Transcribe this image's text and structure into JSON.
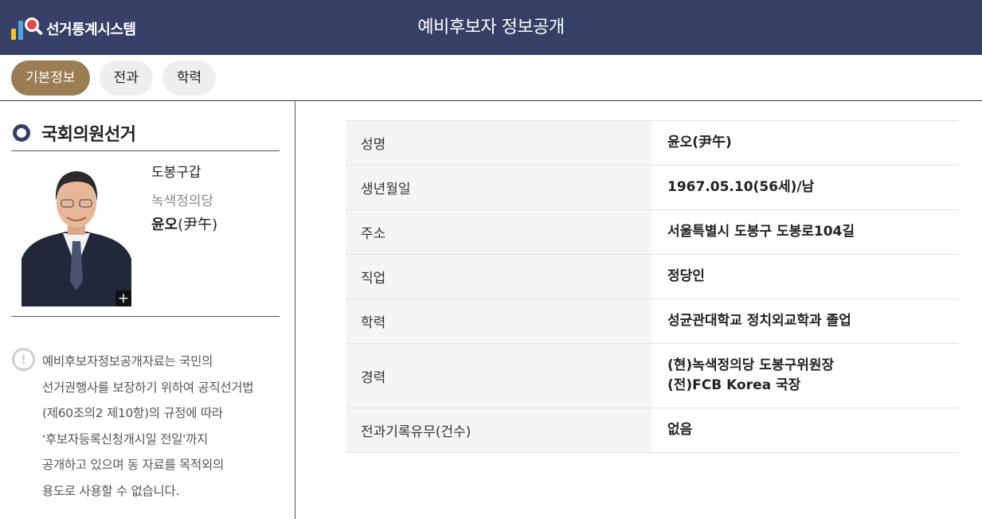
{
  "header": {
    "logo_text": "선거통계시스템",
    "title": "예비후보자 정보공개"
  },
  "tabs": [
    {
      "label": "기본정보",
      "active": true
    },
    {
      "label": "전과",
      "active": false
    },
    {
      "label": "학력",
      "active": false
    }
  ],
  "election": {
    "title": "국회의원선거"
  },
  "candidate": {
    "district": "도봉구갑",
    "party": "녹색정의당",
    "name_hangul": "윤오",
    "name_hanja": "(尹午)",
    "zoom_symbol": "+"
  },
  "notice": {
    "icon": "!",
    "lines": [
      "예비후보자정보공개자료는 국민의",
      "선거권행사를 보장하기 위하여 공직선거법",
      "(제60조의2 제10항)의 규정에 따라",
      "'후보자등록신청개시일 전일'까지",
      "공개하고 있으며 동 자료를 목적외의",
      "용도로 사용할 수 없습니다."
    ]
  },
  "info_rows": [
    {
      "label": "성명",
      "values": [
        "윤오(尹午)"
      ]
    },
    {
      "label": "생년월일",
      "values": [
        "1967.05.10(56세)/남"
      ]
    },
    {
      "label": "주소",
      "values": [
        "서울특별시 도봉구 도봉로104길"
      ]
    },
    {
      "label": "직업",
      "values": [
        "정당인"
      ]
    },
    {
      "label": "학력",
      "values": [
        "성균관대학교 정치외교학과 졸업"
      ]
    },
    {
      "label": "경력",
      "values": [
        "(현)녹색정의당 도봉구위원장",
        "(전)FCB Korea 국장"
      ]
    },
    {
      "label": "전과기록유무(건수)",
      "values": [
        "없음"
      ]
    }
  ],
  "colors": {
    "header_bg": "#364066",
    "active_tab": "#9a7d53"
  }
}
